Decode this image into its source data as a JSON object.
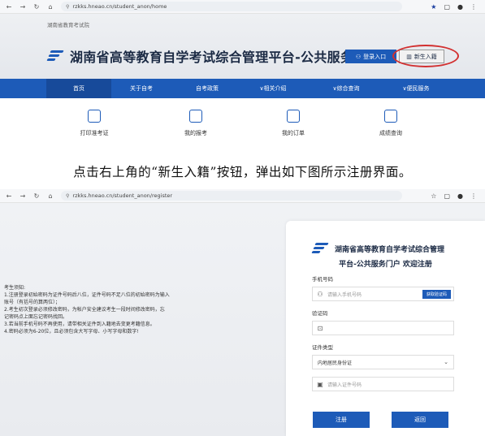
{
  "browser_top": {
    "url": "rzkks.hneao.cn/student_anon/home"
  },
  "browser_bottom": {
    "url": "rzkks.hneao.cn/student_anon/register"
  },
  "home": {
    "org_name": "湖南省教育考试院",
    "site_title": "湖南省高等教育自学考试综合管理平台-公共服务门户",
    "login_label": "登录入口",
    "new_student_label": "新生入籍",
    "nav": [
      "首页",
      "关于自考",
      "自考政策",
      "∨相关介绍",
      "∨综合查询",
      "∨便民服务"
    ],
    "quick_links": [
      "打印准考证",
      "我的报考",
      "我的订单",
      "成绩查询"
    ]
  },
  "caption": "点击右上角的“新生入籍”按钮，弹出如下图所示注册界面。",
  "register": {
    "notice_title": "考生须知:",
    "notice_lines": [
      "1.注册登录初始密码为证件号码后八位，证件号码不足八位的初始密码为输入",
      "账号（有括号的算两位）；",
      "2.考生初次登录必须修改密码，为帐户安全建议考生一段时间修改密码，忘",
      "记密码点上面忘记密码找回。",
      "3.若当前手机号码不再使用，请带相关证件到入籍地去变更考籍信息。",
      "4.密码必须为6-20位，且必须包含大写字母、小写字母和数字!"
    ],
    "title_line1": "湖南省高等教育自学考试综合管理",
    "title_line2": "平台-公共服务门户 欢迎注册",
    "phone_label": "手机号码",
    "phone_placeholder": "请输入手机号码",
    "sms_button": "获取验证码",
    "code_label": "验证码",
    "id_type_label": "证件类型",
    "id_type_value": "内地居民身份证",
    "id_placeholder": "请输入证件号码",
    "submit_label": "注册",
    "back_label": "返回"
  }
}
